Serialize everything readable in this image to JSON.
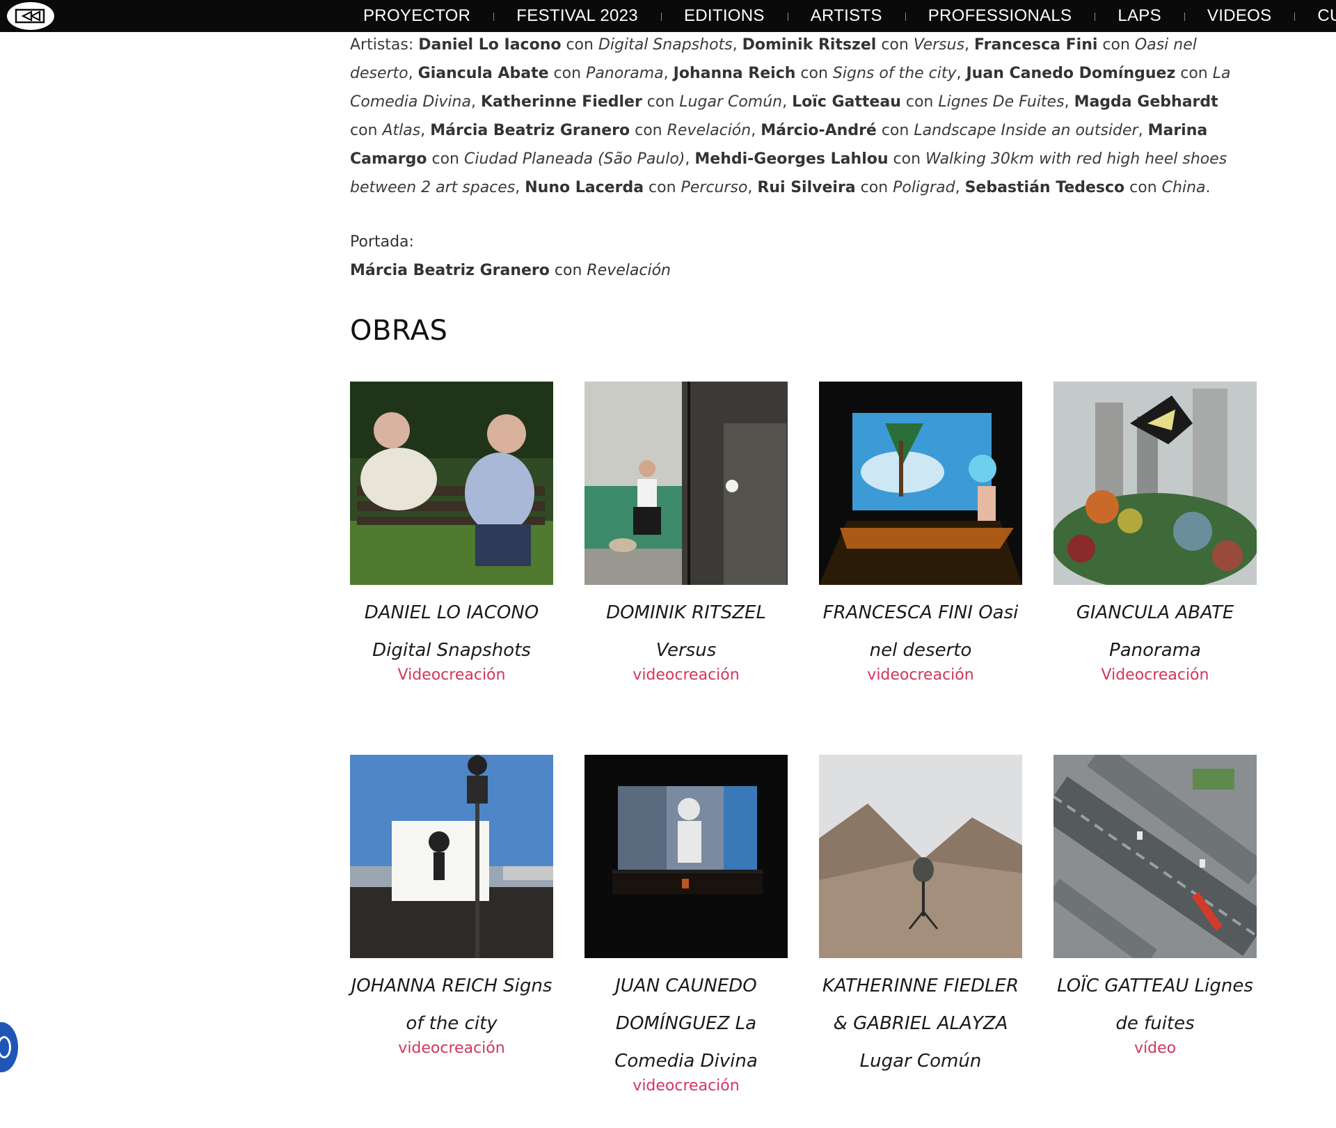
{
  "nav": {
    "logo_icon": "rewind-logo-icon",
    "items": [
      "PROYECTOR",
      "FESTIVAL 2023",
      "EDITIONS",
      "ARTISTS",
      "PROFESSIONALS",
      "LAPS",
      "VIDEOS",
      "CURATOR"
    ]
  },
  "intro": {
    "artists_label": "Artistas: ",
    "artists": [
      {
        "name": "Daniel Lo Iacono",
        "work": "Digital Snapshots"
      },
      {
        "name": "Dominik Ritszel",
        "work": "Versus"
      },
      {
        "name": "Francesca Fini",
        "work": "Oasi nel deserto"
      },
      {
        "name": "Giancula Abate",
        "work": "Panorama"
      },
      {
        "name": "Johanna Reich",
        "work": "Signs of the city"
      },
      {
        "name": "Juan Canedo Domínguez",
        "work": "La Comedia Divina"
      },
      {
        "name": "Katherinne Fiedler",
        "work": "Lugar Común"
      },
      {
        "name": "Loïc Gatteau",
        "work": "Lignes De Fuites"
      },
      {
        "name": "Magda Gebhardt",
        "work": "Atlas"
      },
      {
        "name": "Márcia Beatriz Granero",
        "work": "Revelación"
      },
      {
        "name": "Márcio-André",
        "work": "Landscape Inside an outsider"
      },
      {
        "name": "Marina Camargo",
        "work": "Ciudad Planeada (São Paulo)"
      },
      {
        "name": "Mehdi-Georges Lahlou",
        "work": "Walking 30km with red high heel shoes between 2 art spaces"
      },
      {
        "name": "Nuno Lacerda",
        "work": "Percurso"
      },
      {
        "name": "Rui Silveira",
        "work": "Poligrad"
      },
      {
        "name": "Sebastián Tedesco",
        "work": "China"
      }
    ],
    "connector": "con",
    "portada_label": "Portada:",
    "portada_artist": "Márcia Beatriz Granero",
    "portada_work": "Revelación"
  },
  "obras": {
    "title": "OBRAS",
    "items": [
      {
        "title": "DANIEL LO IACONO Digital Snapshots",
        "category": "Videocreación",
        "thumb": "two-men-on-park-bench"
      },
      {
        "title": "DOMINIK RITSZEL Versus",
        "category": "videocreación",
        "thumb": "man-kneeling-split-screen"
      },
      {
        "title": "FRANCESCA FINI Oasi nel deserto",
        "category": "videocreación",
        "thumb": "projection-palm-graffiti"
      },
      {
        "title": "GIANCULA ABATE Panorama",
        "category": "Videocreación",
        "thumb": "butterfly-city-collage"
      },
      {
        "title": "JOHANNA REICH Signs of the city",
        "category": "videocreación",
        "thumb": "blank-sign-board"
      },
      {
        "title": "JUAN CAUNEDO DOMÍNGUEZ La Comedia Divina",
        "category": "videocreación",
        "thumb": "outdoor-screen-night"
      },
      {
        "title": "KATHERINNE FIEDLER & GABRIEL ALAYZA Lugar Común",
        "category": "",
        "thumb": "desert-loudspeaker"
      },
      {
        "title": "LOÏC GATTEAU Lignes de fuites",
        "category": "vídeo",
        "thumb": "aerial-highway"
      }
    ]
  },
  "colors": {
    "accent": "#d2355f",
    "nav_bg": "#0a0a0a",
    "text": "#333333"
  }
}
